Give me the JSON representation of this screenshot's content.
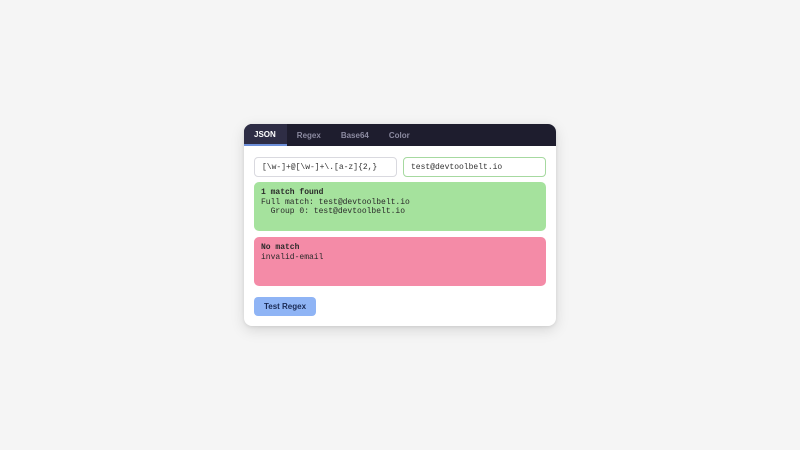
{
  "tabs": [
    {
      "label": "JSON",
      "active": true
    },
    {
      "label": "Regex",
      "active": false
    },
    {
      "label": "Base64",
      "active": false
    },
    {
      "label": "Color",
      "active": false
    }
  ],
  "regex": {
    "pattern_value": "[\\w-]+@[\\w-]+\\.[a-z]{2,}",
    "test_value": "test@devtoolbelt.io"
  },
  "results": {
    "match": {
      "heading": "1 match found",
      "full_match": "Full match: test@devtoolbelt.io",
      "group": "  Group 0: test@devtoolbelt.io"
    },
    "nomatch": {
      "heading": "No match",
      "input": "invalid-email"
    }
  },
  "button": {
    "label": "Test Regex"
  },
  "colors": {
    "tabbar_bg": "#1e1d2e",
    "match_bg": "#a5e29d",
    "nomatch_bg": "#f48ba7",
    "button_bg": "#8fb4f5"
  }
}
